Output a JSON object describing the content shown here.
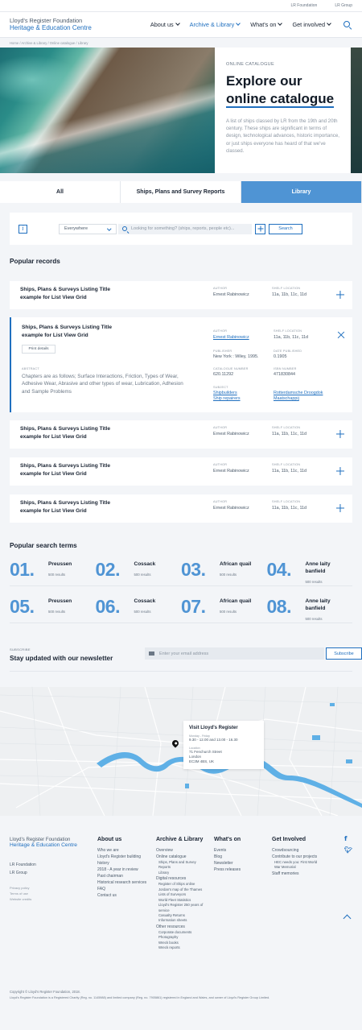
{
  "util": {
    "links": [
      "LR Foundation",
      "LR Group"
    ]
  },
  "header": {
    "logo_line1": "Lloyd's Register Foundation",
    "logo_line2": "Heritage & Education Centre",
    "nav": [
      "About us",
      "Archive & Library",
      "What's on",
      "Get involved"
    ]
  },
  "breadcrumb": "Home / Archive & Library / Online catalogue / Library",
  "hero": {
    "kicker": "ONLINE CATALOGUE",
    "title_line1": "Explore our",
    "title_line2": "online catalogue",
    "description": "A list of ships classed by LR from the 19th and 20th century. These ships are significant in terms of design, technological advances, historic importance, or just ships everyone has heard of that we've classed."
  },
  "tabs": [
    "All",
    "Ships, Plans and Survey Reports",
    "Library"
  ],
  "search": {
    "scope": "Everywhere",
    "placeholder": "Looking for something? (ships, reports, people etc)...",
    "button": "Search"
  },
  "popular_records": {
    "heading": "Popular records",
    "labels": {
      "author": "AUTHOR",
      "shelf": "SHELF LOCATION",
      "publisher": "PUBLISHER",
      "date": "DATE PUBLISHED",
      "catalogue": "CATALOGUE NUMBER",
      "isbn": "ISBN NUMBER",
      "subject": "SUBJECT",
      "abstract": "ABSTRACT"
    },
    "title_line1": "Ships, Plans & Surveys Listing Title",
    "title_line2": "example for List View Grid",
    "author": "Ernest Rabinowicz",
    "shelf": "11a, 11b, 11c, 11d",
    "expanded": {
      "print": "Print details",
      "publisher": "New York : Wiley, 1995.",
      "date": "0.1905",
      "catalogue": "620.11292",
      "isbn": "471830844",
      "subject_left": [
        "Shipbuilders",
        "Ship repairers"
      ],
      "subject_right": [
        "Rotterdamsche Droogdok",
        "Maatschappij"
      ],
      "abstract": "Chapters are as follows; Surface Interactions, Friction, Types of Wear, Adhesive Wear, Abrasive and other types of wear, Lubrication, Adhesion and Sample Problems"
    }
  },
  "popular_terms": {
    "heading": "Popular search terms",
    "items": [
      {
        "num": "01.",
        "name": "Preussen",
        "results": "500 results"
      },
      {
        "num": "02.",
        "name": "Cossack",
        "results": "500 results"
      },
      {
        "num": "03.",
        "name": "African quail",
        "results": "500 results"
      },
      {
        "num": "04.",
        "name": "Anne laity banfield",
        "results": "500 results"
      },
      {
        "num": "05.",
        "name": "Preussen",
        "results": "500 results"
      },
      {
        "num": "06.",
        "name": "Cossack",
        "results": "500 results"
      },
      {
        "num": "07.",
        "name": "African quail",
        "results": "500 results"
      },
      {
        "num": "08.",
        "name": "Anne laity banfield",
        "results": "500 results"
      }
    ]
  },
  "newsletter": {
    "kicker": "SUBSCRIBE",
    "title": "Stay updated with our newsletter",
    "placeholder": "Enter your email address",
    "button": "Subscribe"
  },
  "map": {
    "title": "Visit Lloyd's Register",
    "hours_label": "Monday - Friday",
    "hours": "9.30 - 12.00 and 13.00 - 16.30",
    "location_label": "Location",
    "address": [
      "71 Fenchurch Street",
      "London",
      "EC3M 4BS, UK"
    ]
  },
  "footer": {
    "logo_line1": "Lloyd's Register Foundation",
    "logo_line2": "Heritage & Education Centre",
    "links": [
      "LR Foundation",
      "LR Group"
    ],
    "small": [
      "Privacy policy",
      "Terms of use",
      "Website credits"
    ],
    "about": {
      "heading": "About us",
      "items": [
        "Who we are",
        "Lloyd's Register building history",
        "2018 - A year in review",
        "Past chairman",
        "Historical research services",
        "FAQ",
        "Contact us"
      ]
    },
    "archive": {
      "heading": "Archive & Library",
      "overview": "Overview",
      "online": "Online catalogue",
      "online_sub": [
        "Ships, Plans and Survey Reports",
        "Library"
      ],
      "digital": "Digital resources",
      "digital_sub": [
        "Register of Ships online",
        "Jordan's map of the Thames",
        "Lists of Surveyors",
        "World Fleet Statistics",
        "Lloyd's Register 250 years of service",
        "Casualty Returns",
        "Information sheets"
      ],
      "other": "Other resources",
      "other_sub": [
        "Corporate documents",
        "Photography",
        "Wreck books",
        "Wreck reports"
      ]
    },
    "whatson": {
      "heading": "What's on",
      "items": [
        "Events",
        "Blog",
        "Newsletter",
        "Press releases"
      ]
    },
    "involved": {
      "heading": "Get Involved",
      "items": [
        "Crowdsourcing",
        "Contribute to our projects"
      ],
      "sub": "HEC needs you: First World War Memorial",
      "last": "Staff memories"
    },
    "copyright": "Copyright © Lloyd's Register Foundation, 2018.",
    "legal": "Lloyd's Register Foundation is a Registered Charity (Reg. no. 1145988) and limited company (Reg. no. 7905861) registered in England and Wales, and owner of Lloyd's Register Group Limited."
  }
}
